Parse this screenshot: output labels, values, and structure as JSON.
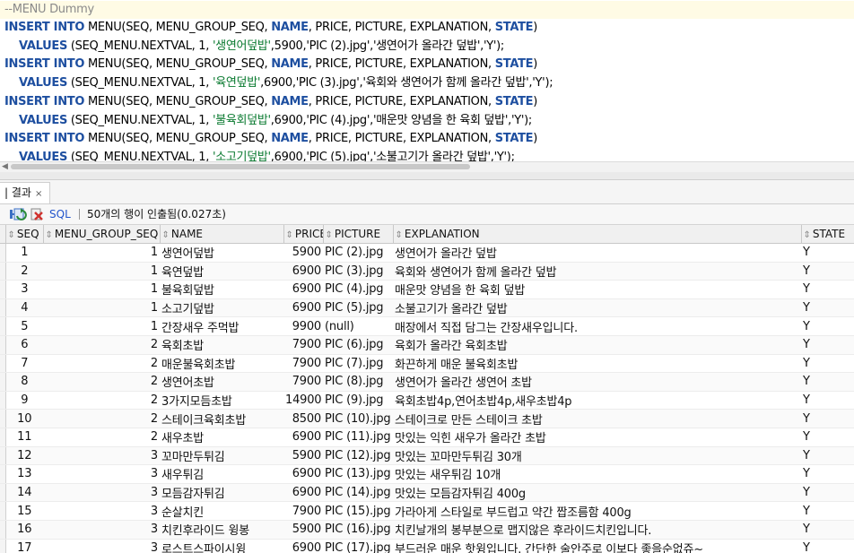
{
  "editor": {
    "comment": "--MENU Dummy",
    "inserts": [
      {
        "values_args": "(SEQ_MENU.NEXTVAL, 1, ",
        "name": "'생연어덮밥'",
        "rest": ",5900,'PIC (2).jpg','생연어가 올라간 덮밥','Y');"
      },
      {
        "values_args": "(SEQ_MENU.NEXTVAL, 1, ",
        "name": "'육연덮밥'",
        "rest": ",6900,'PIC (3).jpg','육회와 생연어가 함께 올라간 덮밥','Y');"
      },
      {
        "values_args": "(SEQ_MENU.NEXTVAL, 1, ",
        "name": "'불육회덮밥'",
        "rest": ",6900,'PIC (4).jpg','매운맛 양념을 한 육회 덮밥','Y');"
      },
      {
        "values_args": "(SEQ_MENU.NEXTVAL, 1, ",
        "name": "'소고기덮밥'",
        "rest": ",6900,'PIC (5).jpg','소불고기가 올라간 덮밥','Y');"
      }
    ],
    "insert_kw": "INSERT INTO",
    "insert_table": " MENU(SEQ, MENU_GROUP_SEQ, ",
    "name_col": "NAME",
    "insert_cols_rest": ", PRICE, PICTURE, EXPLANATION, ",
    "state_col": "STATE",
    "insert_close": ")",
    "values_kw": "VALUES",
    "seq_kw": "SEQ_MENU.",
    "nextval_kw": "NEXTVAL"
  },
  "result_tab": {
    "label": "| 결과",
    "close": "×"
  },
  "toolbar": {
    "sql_label": "SQL",
    "status": "50개의 행이 인출됨(0.027초)"
  },
  "columns": [
    "SEQ",
    "MENU_GROUP_SEQ",
    "NAME",
    "PRICE",
    "PICTURE",
    "EXPLANATION",
    "STATE"
  ],
  "rows": [
    [
      "1",
      "1",
      "생연어덮밥",
      "5900",
      "PIC (2).jpg",
      "생연어가 올라간 덮밥",
      "Y"
    ],
    [
      "2",
      "1",
      "육연덮밥",
      "6900",
      "PIC (3).jpg",
      "육회와 생연어가 함께 올라간 덮밥",
      "Y"
    ],
    [
      "3",
      "1",
      "불육회덮밥",
      "6900",
      "PIC (4).jpg",
      "매운맛 양념을 한 육회 덮밥",
      "Y"
    ],
    [
      "4",
      "1",
      "소고기덮밥",
      "6900",
      "PIC (5).jpg",
      "소불고기가 올라간 덮밥",
      "Y"
    ],
    [
      "5",
      "1",
      "간장새우 주먹밥",
      "9900",
      "(null)",
      "매장에서 직접 담그는 간장새우입니다.",
      "Y"
    ],
    [
      "6",
      "2",
      "육회초밥",
      "7900",
      "PIC (6).jpg",
      "육회가 올라간 육회초밥",
      "Y"
    ],
    [
      "7",
      "2",
      "매운불육회초밥",
      "7900",
      "PIC (7).jpg",
      "화끈하게 매운 불육회초밥",
      "Y"
    ],
    [
      "8",
      "2",
      "생연어초밥",
      "7900",
      "PIC (8).jpg",
      "생연어가 올라간 생연어 초밥",
      "Y"
    ],
    [
      "9",
      "2",
      "3가지모듬초밥",
      "14900",
      "PIC (9).jpg",
      "육회초밥4p,연어초밥4p,새우초밥4p",
      "Y"
    ],
    [
      "10",
      "2",
      "스테이크육회초밥",
      "8500",
      "PIC (10).jpg",
      "스테이크로 만든 스테이크 초밥",
      "Y"
    ],
    [
      "11",
      "2",
      "새우초밥",
      "6900",
      "PIC (11).jpg",
      "맛있는 익힌 새우가 올라간 초밥",
      "Y"
    ],
    [
      "12",
      "3",
      "꼬마만두튀김",
      "5900",
      "PIC (12).jpg",
      "맛있는 꼬마만두튀김 30개",
      "Y"
    ],
    [
      "13",
      "3",
      "새우튀김",
      "6900",
      "PIC (13).jpg",
      "맛있는 새우튀김 10개",
      "Y"
    ],
    [
      "14",
      "3",
      "모듬감자튀김",
      "6900",
      "PIC (14).jpg",
      "맛있는 모듬감자튀김 400g",
      "Y"
    ],
    [
      "15",
      "3",
      "순살치킨",
      "7900",
      "PIC (15).jpg",
      "가라아게 스타일로 부드럽고 약간 짭조름함 400g",
      "Y"
    ],
    [
      "16",
      "3",
      "치킨후라이드 윙봉",
      "5900",
      "PIC (16).jpg",
      "치킨날개의 봉부분으로 맵지않은 후라이드치킨입니다.",
      "Y"
    ],
    [
      "17",
      "3",
      "로스트스파이시윙",
      "6900",
      "PIC (17).jpg",
      "부드러운 매운 핫윙입니다. 간단한 술안주로 이보다 좋을순없쥬~",
      "Y"
    ]
  ],
  "icons": {
    "refresh": "refresh-icon",
    "delete": "delete-icon",
    "sort": "sort-icon"
  },
  "colors": {
    "keyword": "#1e4fa0",
    "comment": "#8a8a8a",
    "string": "#0a7a30",
    "sql_link": "#2255cc"
  }
}
